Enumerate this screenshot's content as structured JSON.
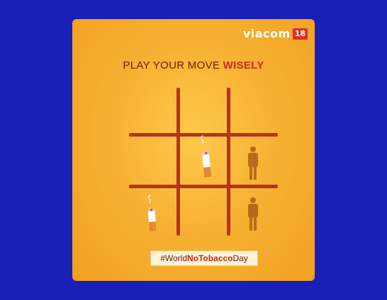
{
  "brand": {
    "name": "viacom",
    "badge": "18"
  },
  "headline": {
    "prefix": "PLAY YOUR MOVE ",
    "emphasis": "WISELY"
  },
  "board": {
    "cells": [
      [
        "",
        "",
        ""
      ],
      [
        "",
        "cigarette",
        "person"
      ],
      [
        "cigarette",
        "",
        "person"
      ]
    ]
  },
  "hashtag": {
    "prefix": "#World",
    "emphasis": "NoTobacco",
    "suffix": "Day"
  },
  "colors": {
    "page_background": "#1a1fb8",
    "card": "#f7b233",
    "grid_line": "#b6331d",
    "accent_red": "#c92a1c",
    "person": "#b86a1a"
  }
}
